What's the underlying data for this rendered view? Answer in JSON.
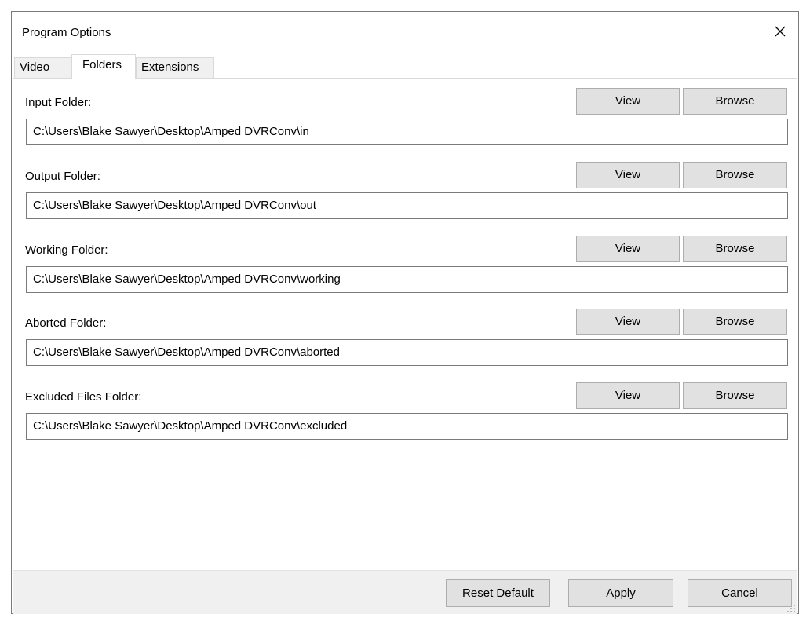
{
  "window": {
    "title": "Program Options",
    "close_glyph": "✕"
  },
  "tabs": [
    {
      "label": "Video",
      "active": false
    },
    {
      "label": "Folders",
      "active": true
    },
    {
      "label": "Extensions",
      "active": false
    }
  ],
  "folders": [
    {
      "label": "Input Folder:",
      "path": "C:\\Users\\Blake Sawyer\\Desktop\\Amped DVRConv\\in",
      "view_label": "View",
      "browse_label": "Browse"
    },
    {
      "label": "Output Folder:",
      "path": "C:\\Users\\Blake Sawyer\\Desktop\\Amped DVRConv\\out",
      "view_label": "View",
      "browse_label": "Browse"
    },
    {
      "label": "Working Folder:",
      "path": "C:\\Users\\Blake Sawyer\\Desktop\\Amped DVRConv\\working",
      "view_label": "View",
      "browse_label": "Browse"
    },
    {
      "label": "Aborted Folder:",
      "path": "C:\\Users\\Blake Sawyer\\Desktop\\Amped DVRConv\\aborted",
      "view_label": "View",
      "browse_label": "Browse"
    },
    {
      "label": "Excluded Files Folder:",
      "path": "C:\\Users\\Blake Sawyer\\Desktop\\Amped DVRConv\\excluded",
      "view_label": "View",
      "browse_label": "Browse"
    }
  ],
  "footer": {
    "reset_label": "Reset Default",
    "apply_label": "Apply",
    "cancel_label": "Cancel"
  },
  "colors": {
    "button_face": "#e1e1e1",
    "button_border": "#adadad",
    "footer_bg": "#f0f0f0",
    "field_border": "#7a7a7a"
  }
}
